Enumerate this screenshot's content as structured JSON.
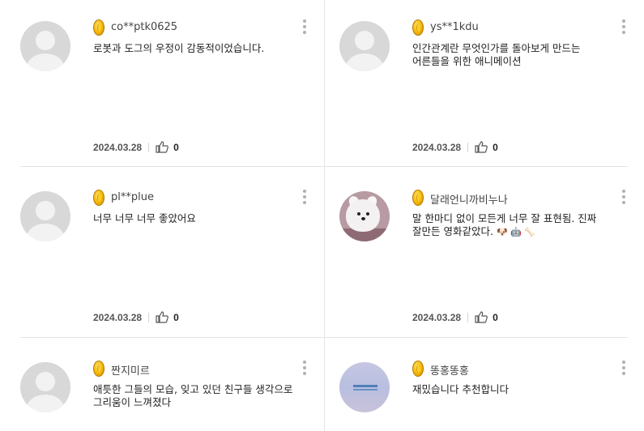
{
  "comments": [
    {
      "nickname": "co**ptk0625",
      "text": "로봇과 도그의 우정이 감동적이었습니다.",
      "date": "2024.03.28",
      "likes": "0",
      "avatar": "default-avatar"
    },
    {
      "nickname": "ys**1kdu",
      "text": "인간관계란 무엇인가를 돌아보게 만드는 어른들을 위한 애니메이션",
      "date": "2024.03.28",
      "likes": "0",
      "avatar": "default-avatar"
    },
    {
      "nickname": "pl**plue",
      "text": "너무 너무 너무 좋았어요",
      "date": "2024.03.28",
      "likes": "0",
      "avatar": "default-avatar"
    },
    {
      "nickname": "달래언니까비누나",
      "text": "말 한마디 없이 모든게 너무 잘 표현됨. 진짜 잘만든 영화같았다.",
      "emojis": "🐶 🤖 🦴",
      "date": "2024.03.28",
      "likes": "0",
      "avatar": "dog-photo"
    },
    {
      "nickname": "짠지미르",
      "text": "애틋한 그들의 모습, 잊고 있던 친구들 생각으로 그리움이 느껴졌다",
      "date": "",
      "likes": "",
      "avatar": "default-avatar"
    },
    {
      "nickname": "똥홍똥홍",
      "text": "재밌습니다 추천합니다",
      "date": "",
      "likes": "",
      "avatar": "sky-photo"
    }
  ],
  "icons": {
    "coin": "gold-coin-icon",
    "like": "thumbs-up-icon",
    "more": "more-vertical-icon"
  },
  "colors": {
    "coin": "#f3b400",
    "divider": "#e3e3e3",
    "text": "#222222",
    "meta": "#555555"
  }
}
